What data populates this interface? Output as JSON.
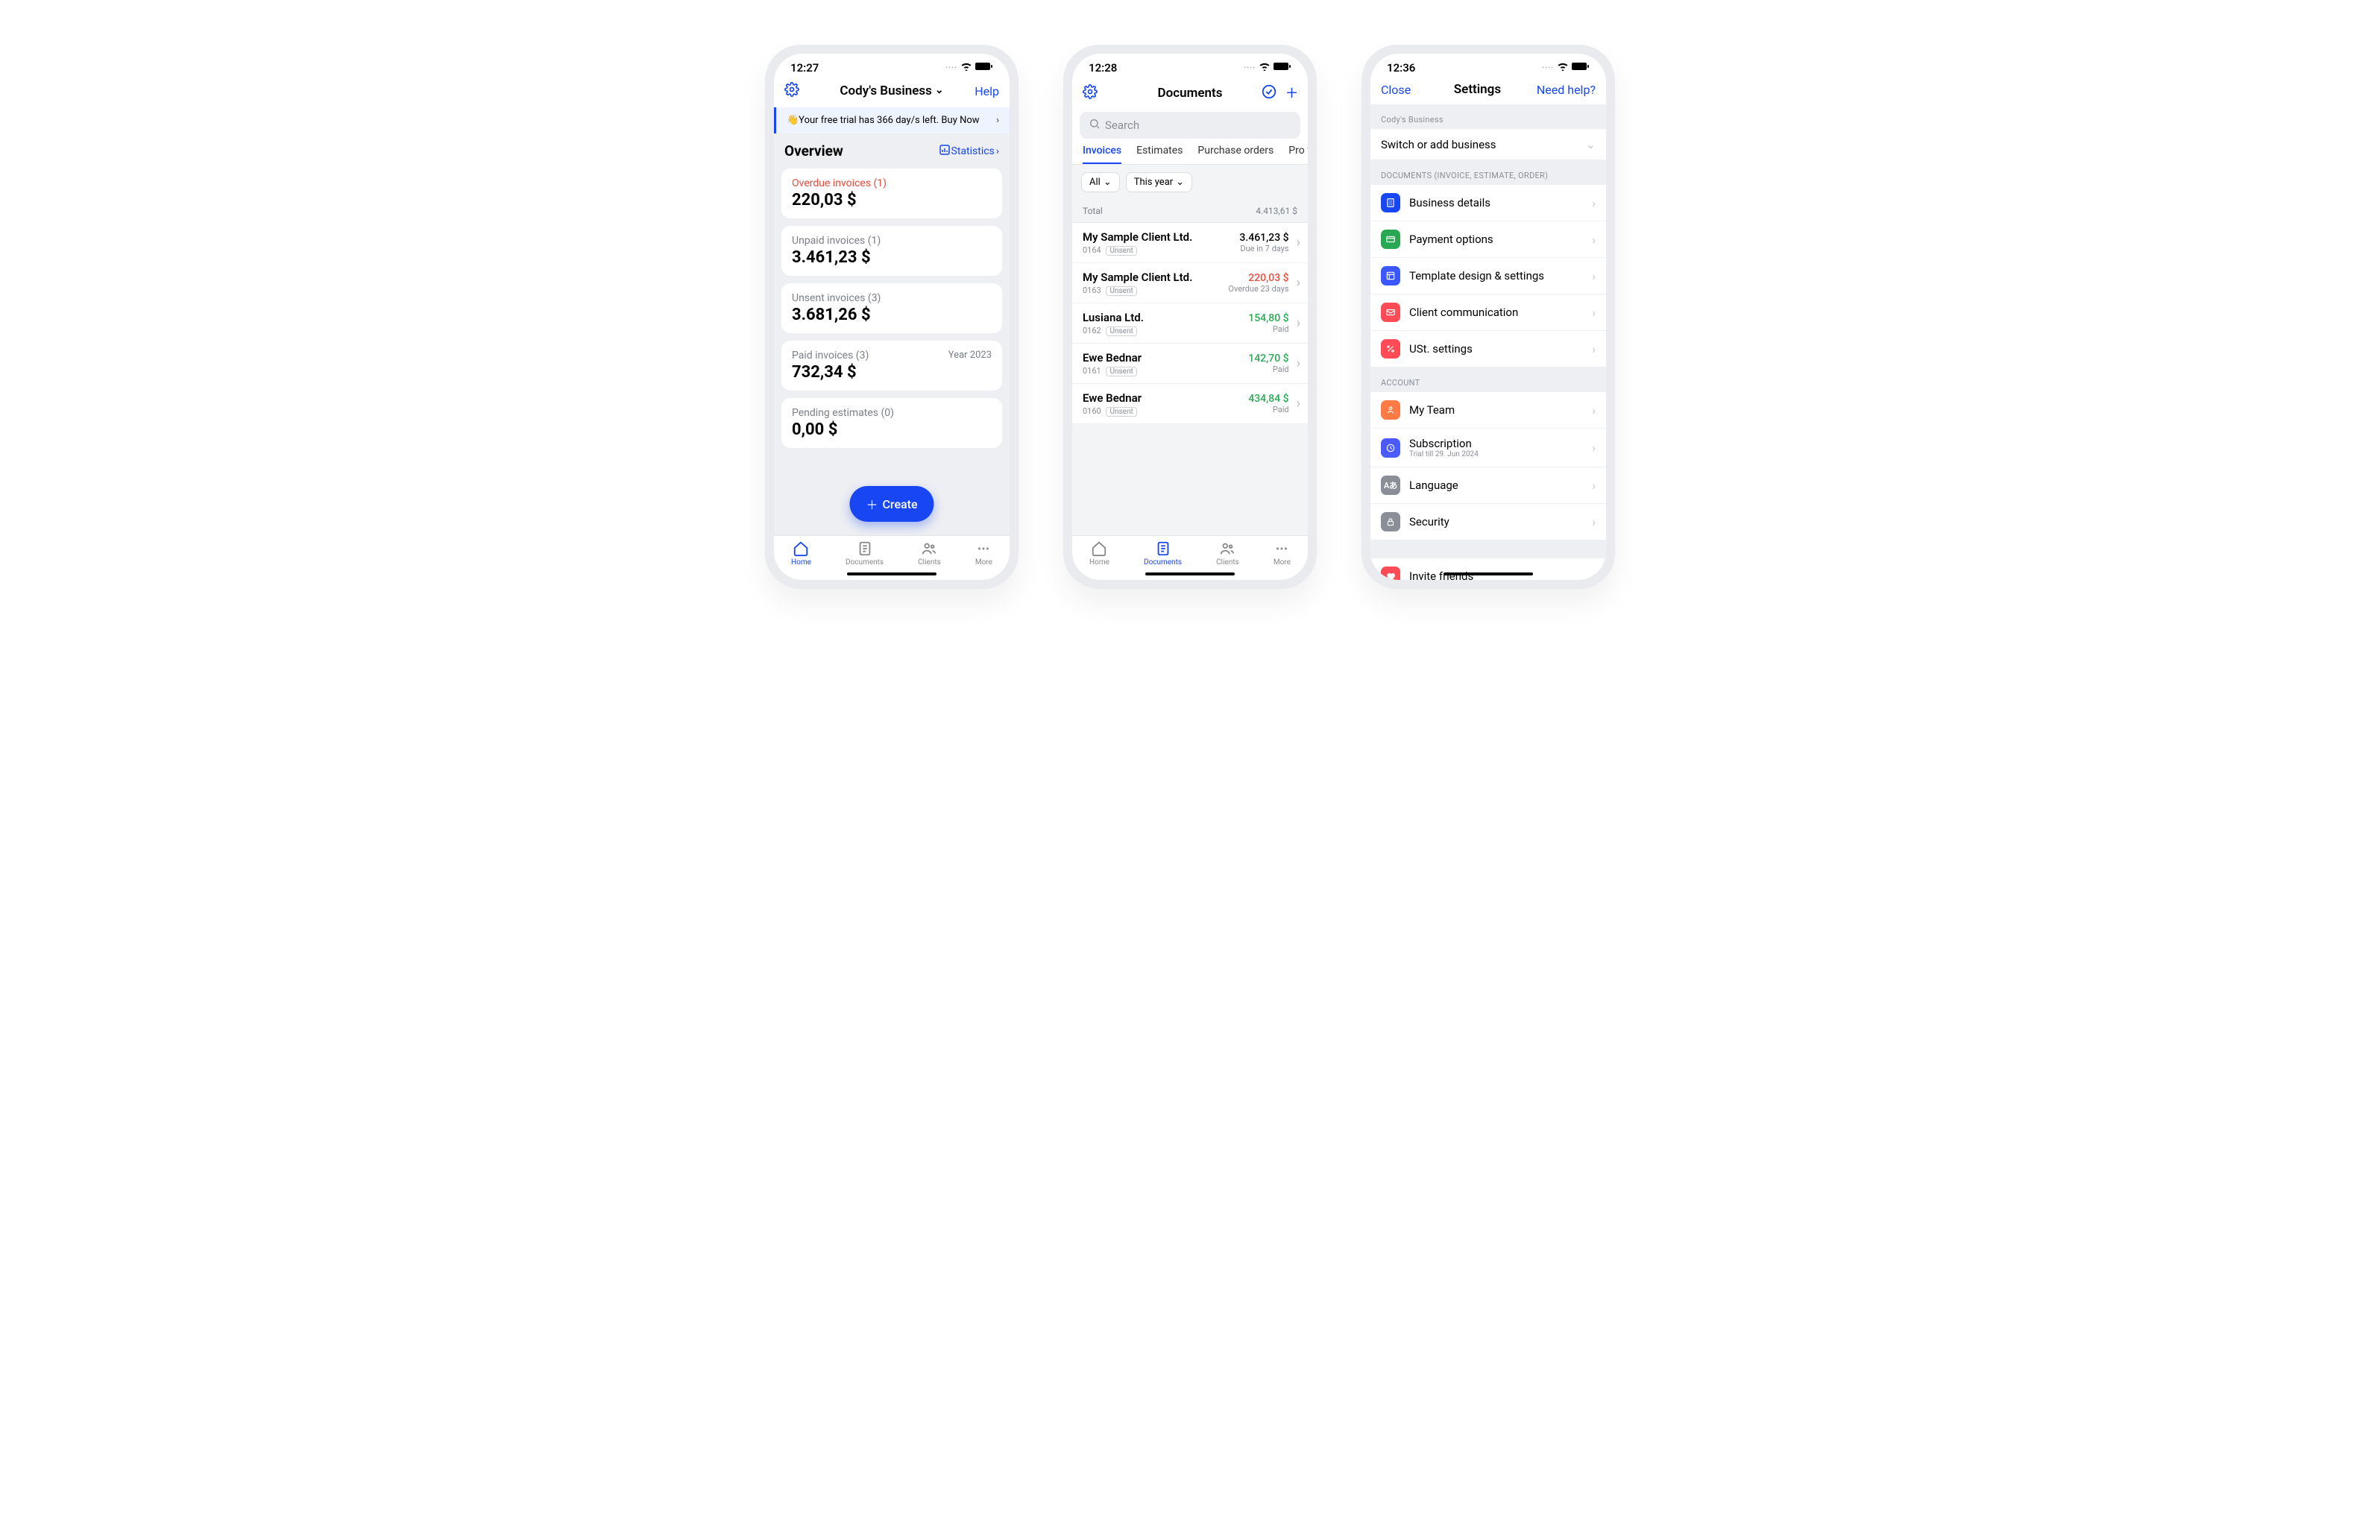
{
  "screen1": {
    "time": "12:27",
    "business": "Cody's Business",
    "help": "Help",
    "promo": "👋Your free trial has 366 day/s left. Buy Now",
    "overview": "Overview",
    "statistics": "Statistics",
    "cards": {
      "overdue": {
        "label": "Overdue invoices (1)",
        "amount": "220,03 $"
      },
      "unpaid": {
        "label": "Unpaid invoices (1)",
        "amount": "3.461,23 $"
      },
      "unsent": {
        "label": "Unsent invoices (3)",
        "amount": "3.681,26 $"
      },
      "paid": {
        "label": "Paid invoices (3)",
        "amount": "732,34 $",
        "meta": "Year 2023"
      },
      "pending": {
        "label": "Pending estimates (0)",
        "amount": "0,00 $"
      }
    },
    "create": "Create",
    "tabs": {
      "home": "Home",
      "documents": "Documents",
      "clients": "Clients",
      "more": "More"
    }
  },
  "screen2": {
    "time": "12:28",
    "title": "Documents",
    "search_placeholder": "Search",
    "tabs": {
      "invoices": "Invoices",
      "estimates": "Estimates",
      "po": "Purchase orders",
      "pf": "Pro f"
    },
    "filters": {
      "all": "All",
      "year": "This year"
    },
    "total_label": "Total",
    "total_amount": "4.413,61 $",
    "rows": [
      {
        "name": "My Sample Client Ltd.",
        "num": "0164",
        "tag": "Unsent",
        "amt": "3.461,23 $",
        "status": "Due in 7 days",
        "color": ""
      },
      {
        "name": "My Sample Client Ltd.",
        "num": "0163",
        "tag": "Unsent",
        "amt": "220,03 $",
        "status": "Overdue 23 days",
        "color": "red"
      },
      {
        "name": "Lusiana Ltd.",
        "num": "0162",
        "tag": "Unsent",
        "amt": "154,80 $",
        "status": "Paid",
        "color": "green"
      },
      {
        "name": "Ewe Bednar",
        "num": "0161",
        "tag": "Unsent",
        "amt": "142,70 $",
        "status": "Paid",
        "color": "green"
      },
      {
        "name": "Ewe Bednar",
        "num": "0160",
        "tag": "Unsent",
        "amt": "434,84 $",
        "status": "Paid",
        "color": "green"
      }
    ],
    "tabs_bottom": {
      "home": "Home",
      "documents": "Documents",
      "clients": "Clients",
      "more": "More"
    }
  },
  "screen3": {
    "time": "12:36",
    "close": "Close",
    "title": "Settings",
    "need_help": "Need help?",
    "biz_header": "Cody's Business",
    "switch": "Switch or add business",
    "docs_header": "DOCUMENTS (INVOICE, ESTIMATE, ORDER)",
    "docs": {
      "business_details": "Business details",
      "payment_options": "Payment options",
      "template": "Template design & settings",
      "client_comm": "Client communication",
      "ust": "USt. settings"
    },
    "account_header": "ACCOUNT",
    "account": {
      "team": "My Team",
      "subscription": "Subscription",
      "subscription_sub": "Trial till 29. Jun 2024",
      "language": "Language",
      "security": "Security"
    },
    "invite": "Invite friends"
  }
}
